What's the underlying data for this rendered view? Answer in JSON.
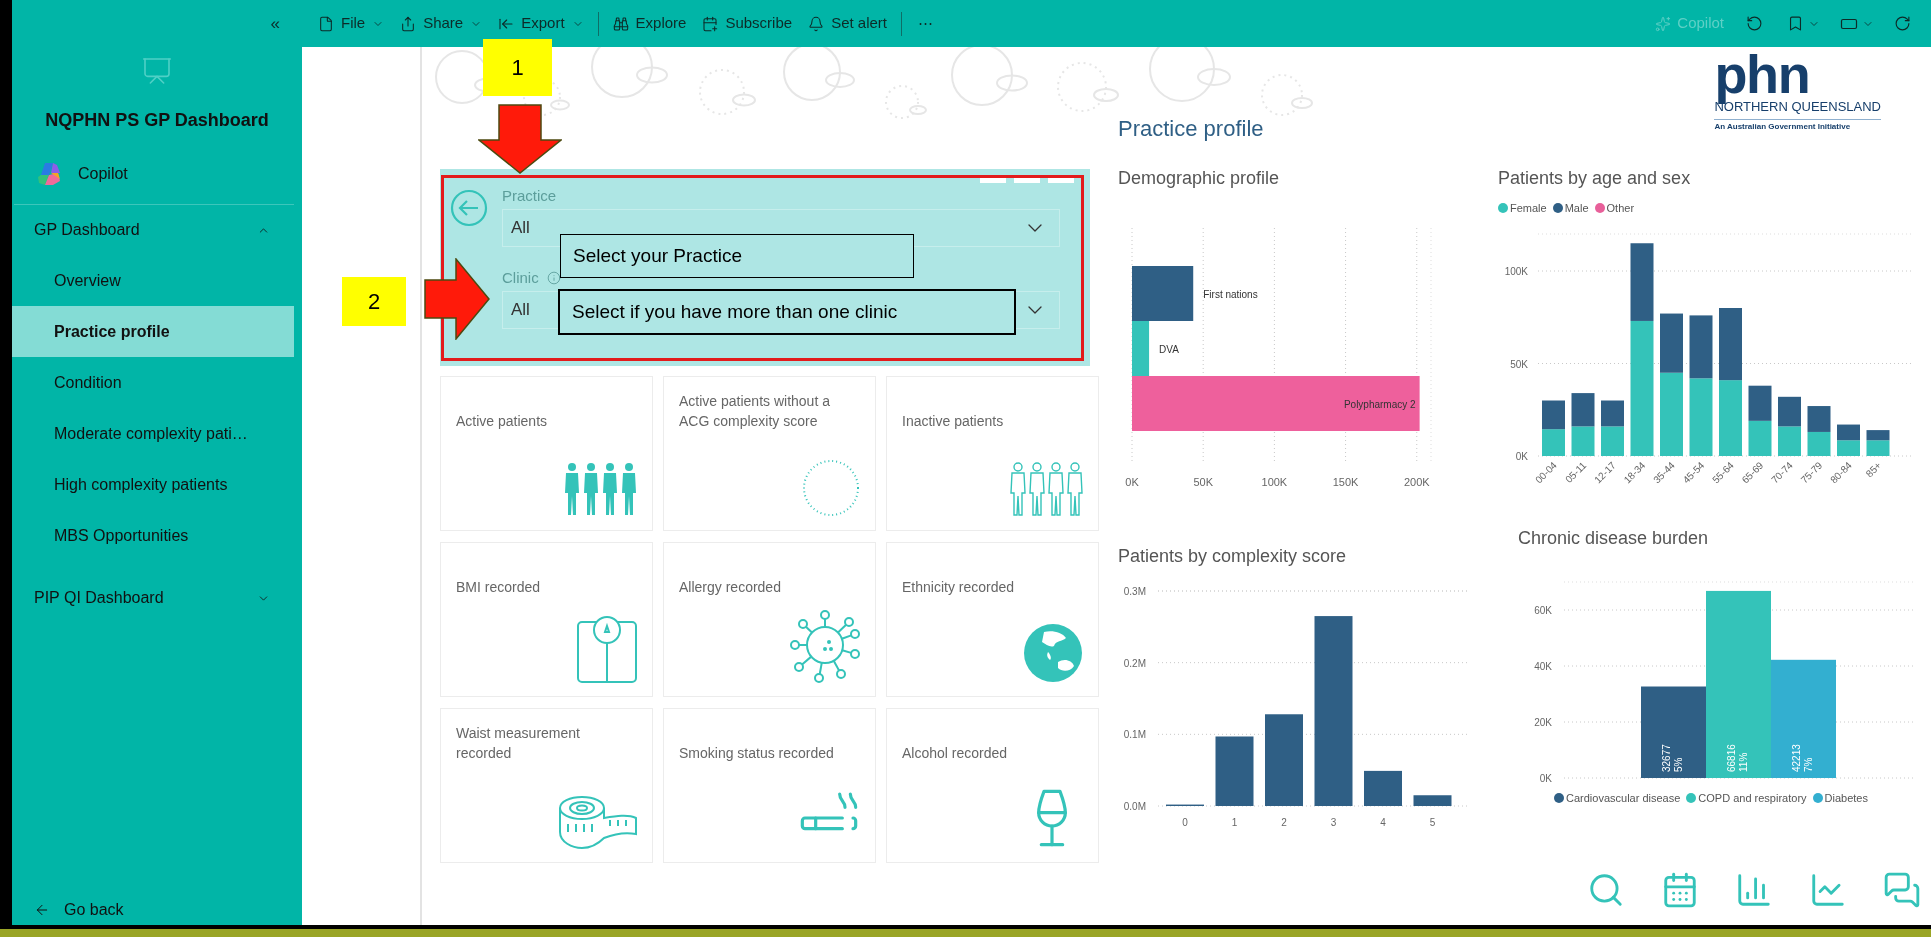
{
  "toolbar": {
    "collapse": "«",
    "items": [
      {
        "label": "File",
        "kind": "file",
        "menu": true,
        "divider_after": false
      },
      {
        "label": "Share",
        "kind": "share",
        "menu": true,
        "divider_after": false
      },
      {
        "label": "Export",
        "kind": "export",
        "menu": true,
        "divider_after": true
      },
      {
        "label": "Explore",
        "kind": "explore",
        "menu": false,
        "divider_after": false
      },
      {
        "label": "Subscribe",
        "kind": "subscribe",
        "menu": false,
        "divider_after": false
      },
      {
        "label": "Set alert",
        "kind": "alert",
        "menu": false,
        "divider_after": true
      }
    ],
    "more": "⋯",
    "copilot": {
      "label": "Copilot",
      "disabled": true
    }
  },
  "sidebar": {
    "title": "NQPHN PS GP Dashboard",
    "copilot": "Copilot",
    "sections": [
      {
        "label": "GP Dashboard",
        "expanded": true,
        "children": [
          {
            "label": "Overview",
            "selected": false
          },
          {
            "label": "Practice profile",
            "selected": true
          },
          {
            "label": "Condition",
            "selected": false
          },
          {
            "label": "Moderate complexity pati…",
            "selected": false
          },
          {
            "label": "High complexity patients",
            "selected": false
          },
          {
            "label": "MBS Opportunities",
            "selected": false
          }
        ]
      },
      {
        "label": "PIP QI Dashboard",
        "expanded": false
      }
    ],
    "go_back": "Go back"
  },
  "annotations": {
    "markers": [
      "1",
      "2"
    ],
    "callouts": [
      "Select your Practice",
      "Select if you have more than one clinic"
    ]
  },
  "report": {
    "title": "Practice profile",
    "logo": {
      "mark": "phn",
      "region": "NORTHERN QUEENSLAND",
      "tagline": "An Australian Government Initiative"
    },
    "slicers": [
      {
        "label": "Practice",
        "value": "All",
        "info": false
      },
      {
        "label": "Clinic",
        "value": "All",
        "info": true
      }
    ],
    "tiles": [
      {
        "title": "Active patients",
        "kind": "people-filled"
      },
      {
        "title": "Active patients without a ACG complexity score",
        "kind": "dotted-circle"
      },
      {
        "title": "Inactive patients",
        "kind": "people-outline"
      },
      {
        "title": "BMI recorded",
        "kind": "scale"
      },
      {
        "title": "Allergy recorded",
        "kind": "virus"
      },
      {
        "title": "Ethnicity recorded",
        "kind": "globe"
      },
      {
        "title": "Waist measurement recorded",
        "kind": "tape"
      },
      {
        "title": "Smoking status recorded",
        "kind": "cigarette"
      },
      {
        "title": "Alcohol recorded",
        "kind": "wine"
      }
    ],
    "charts": [
      {
        "chart_data": {
          "type": "bar",
          "orientation": "horizontal",
          "title": "Demographic profile",
          "stacked": true,
          "grid": true,
          "series": [
            {
              "name": "First nations",
              "color": "#2f5f85",
              "values": [
                43000,
                null,
                null
              ]
            },
            {
              "name": "DVA",
              "color": "#34c3b9",
              "values": [
                null,
                12000,
                null
              ]
            },
            {
              "name": "Polypharmacy 2",
              "color": "#ee609c",
              "values": [
                null,
                null,
                202000
              ]
            }
          ],
          "xlim": [
            0,
            210000
          ],
          "xticks": [
            {
              "value": 0,
              "label": "0K"
            },
            {
              "value": 50000,
              "label": "50K"
            },
            {
              "value": 100000,
              "label": "100K"
            },
            {
              "value": 150000,
              "label": "150K"
            },
            {
              "value": 200000,
              "label": "200K"
            }
          ]
        }
      },
      {
        "chart_data": {
          "type": "bar",
          "orientation": "vertical",
          "title": "Patients by age and sex",
          "stacked": true,
          "grid": true,
          "legend": "top",
          "categories": [
            "00-04",
            "05-11",
            "12-17",
            "18-34",
            "35-44",
            "45-54",
            "55-64",
            "65-69",
            "70-74",
            "75-79",
            "80-84",
            "85+"
          ],
          "ylim": [
            0,
            120000
          ],
          "series": [
            {
              "name": "Female",
              "color": "#34c3b9",
              "values": [
                14500,
                16000,
                16000,
                73000,
                45000,
                42000,
                41000,
                19000,
                16000,
                13000,
                8500,
                8500
              ]
            },
            {
              "name": "Male",
              "color": "#2f5f85",
              "values": [
                15500,
                18000,
                14000,
                42000,
                32000,
                34000,
                39000,
                19000,
                16000,
                14000,
                8500,
                5500
              ]
            },
            {
              "name": "Other",
              "color": "#e8609a",
              "values": [
                0,
                0,
                0,
                0,
                0,
                0,
                0,
                0,
                0,
                0,
                0,
                0
              ]
            }
          ],
          "yticks": [
            {
              "value": 0,
              "label": "0K"
            },
            {
              "value": 50000,
              "label": "50K"
            },
            {
              "value": 100000,
              "label": "100K"
            }
          ]
        }
      },
      {
        "chart_data": {
          "type": "bar",
          "orientation": "vertical",
          "title": "Patients by complexity score",
          "grid": true,
          "categories": [
            "0",
            "1",
            "2",
            "3",
            "4",
            "5"
          ],
          "values": [
            2000,
            97000,
            128000,
            265000,
            49000,
            15000
          ],
          "ylim": [
            0,
            300000
          ],
          "yticks": [
            {
              "value": 0,
              "label": "0.0M"
            },
            {
              "value": 100000,
              "label": "0.1M"
            },
            {
              "value": 200000,
              "label": "0.2M"
            },
            {
              "value": 300000,
              "label": "0.3M"
            }
          ]
        }
      },
      {
        "chart_data": {
          "type": "bar",
          "orientation": "vertical",
          "title": "Chronic disease burden",
          "grid": true,
          "legend": "bottom",
          "series": [
            {
              "name": "Cardiovascular disease",
              "color": "#2f5f85",
              "values": [
                32677
              ]
            },
            {
              "name": "COPD and respiratory",
              "color": "#34c3b9",
              "values": [
                66816
              ]
            },
            {
              "name": "Diabetes",
              "color": "#33afd0",
              "values": [
                42213
              ]
            }
          ],
          "ylim": [
            0,
            70000
          ],
          "value_labels": [
            [
              "32677",
              "5%"
            ],
            [
              "66816",
              "11%"
            ],
            [
              "42213",
              "7%"
            ]
          ],
          "yticks": [
            {
              "value": 0,
              "label": "0K"
            },
            {
              "value": 20000,
              "label": "20K"
            },
            {
              "value": 40000,
              "label": "40K"
            },
            {
              "value": 60000,
              "label": "60K"
            }
          ]
        }
      }
    ]
  }
}
